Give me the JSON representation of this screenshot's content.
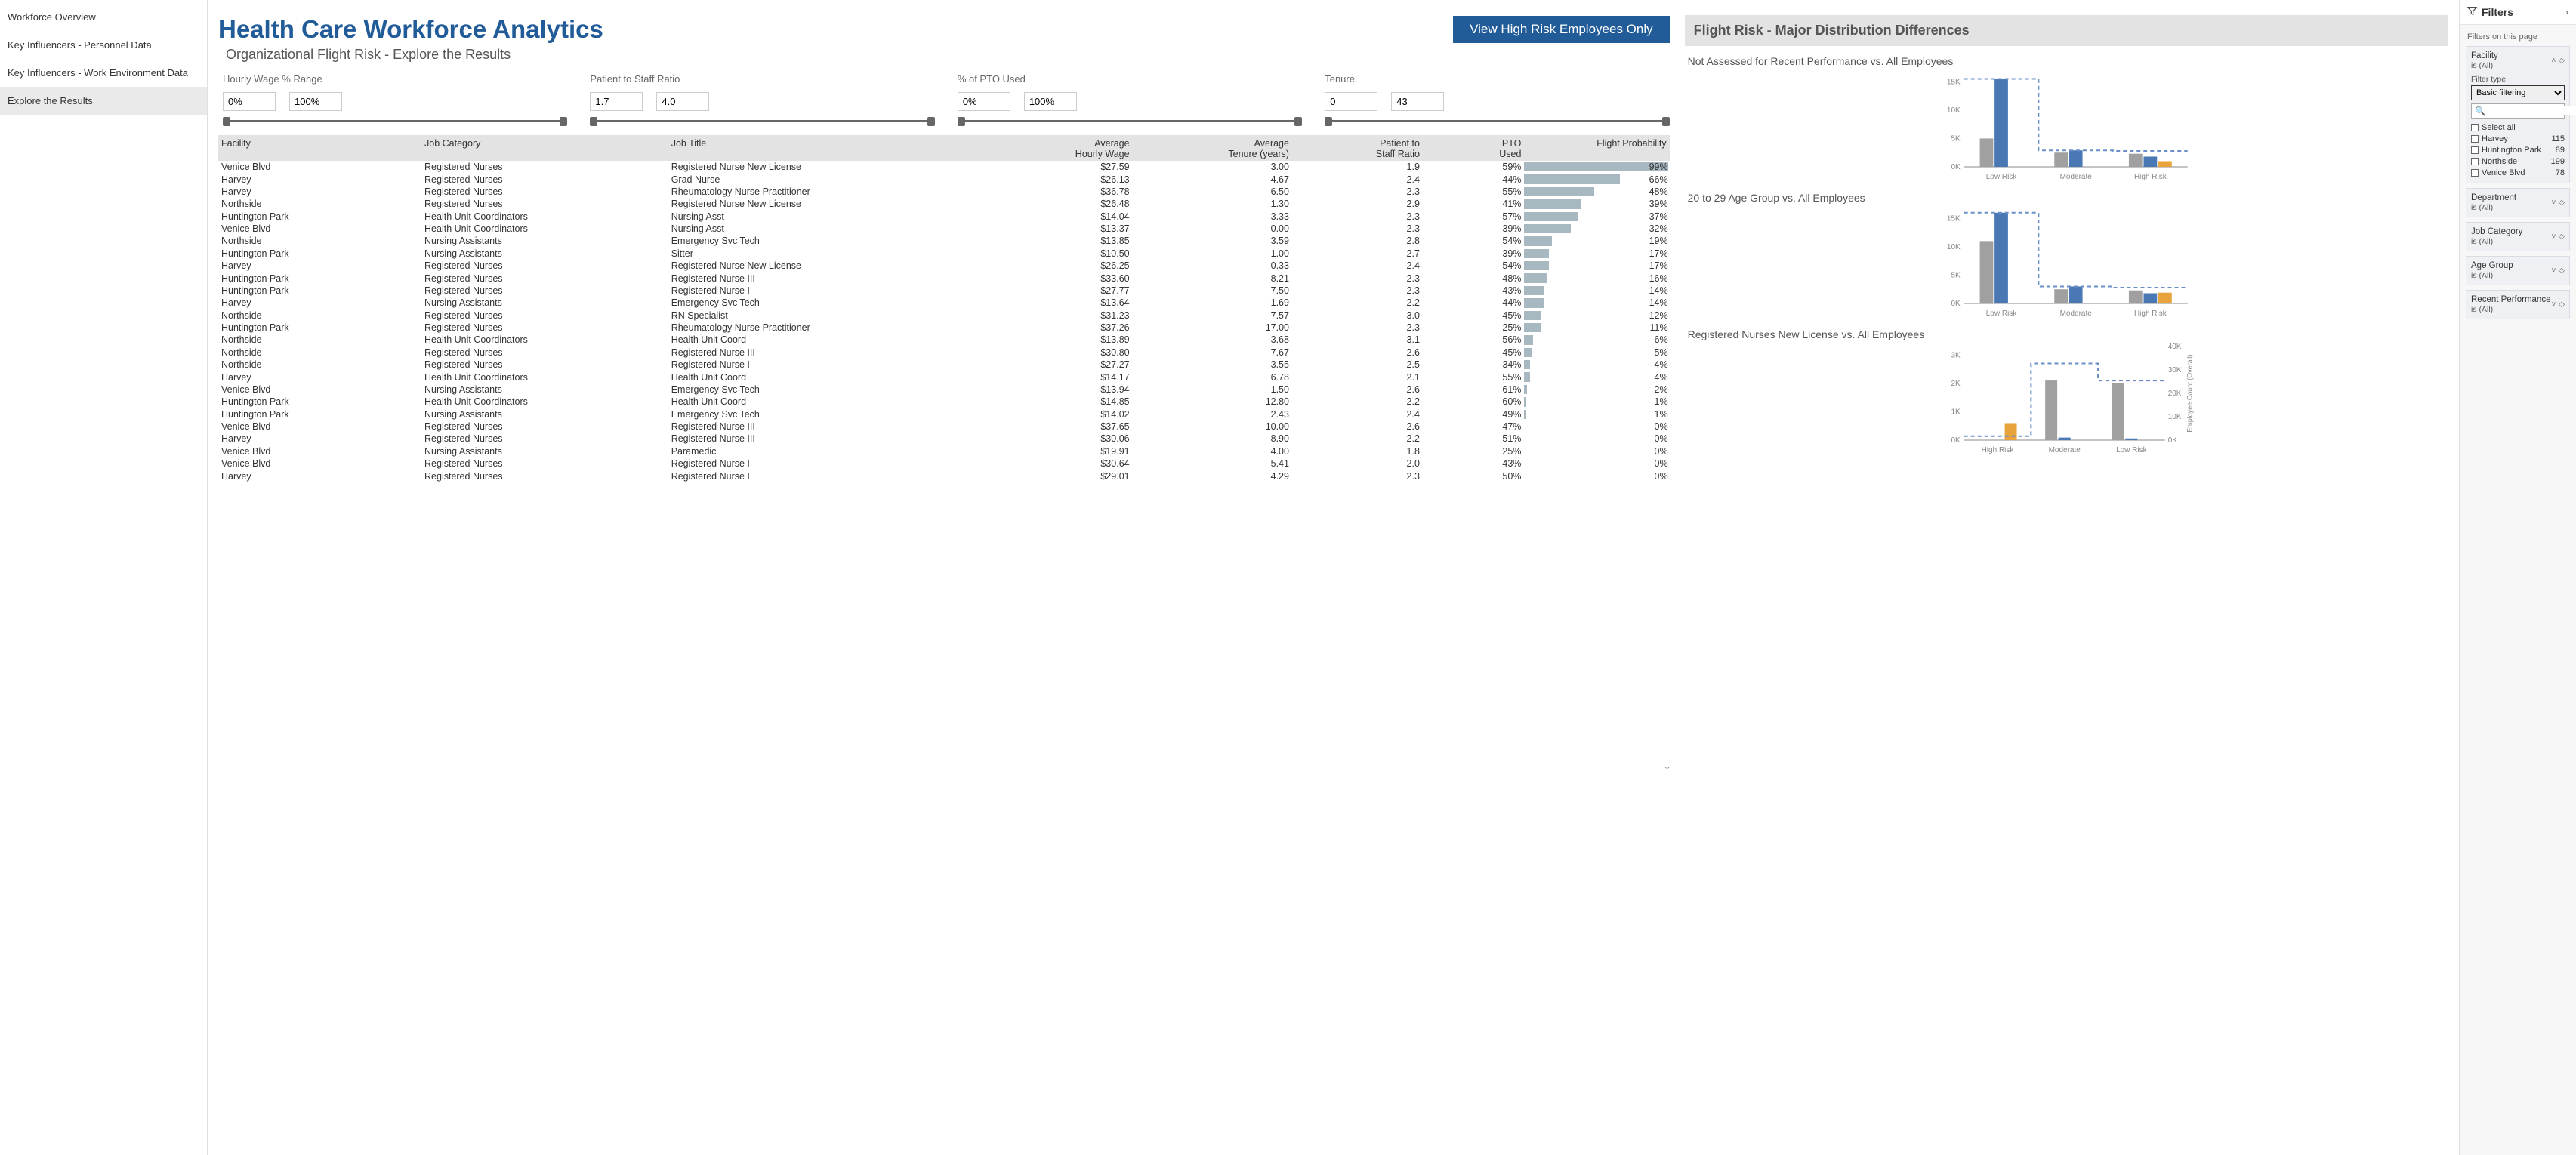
{
  "nav": {
    "items": [
      {
        "label": "Workforce Overview",
        "active": false
      },
      {
        "label": "Key Influencers - Personnel Data",
        "active": false
      },
      {
        "label": "Key Influencers - Work Environment Data",
        "active": false
      },
      {
        "label": "Explore the Results",
        "active": true
      }
    ]
  },
  "header": {
    "title": "Health Care Workforce Analytics",
    "button": "View High Risk Employees Only",
    "subtitle": "Organizational Flight Risk - Explore the Results"
  },
  "slicers": [
    {
      "label": "Hourly Wage % Range",
      "from": "0%",
      "to": "100%"
    },
    {
      "label": "Patient to Staff Ratio",
      "from": "1.7",
      "to": "4.0"
    },
    {
      "label": "% of PTO Used",
      "from": "0%",
      "to": "100%"
    },
    {
      "label": "Tenure",
      "from": "0",
      "to": "43"
    }
  ],
  "table": {
    "columns": [
      "Facility",
      "Job Category",
      "Job Title",
      "Average Hourly Wage",
      "Average Tenure (years)",
      "Patient to Staff Ratio",
      "PTO Used",
      "Flight Probability"
    ],
    "rows": [
      {
        "facility": "Venice Blvd",
        "category": "Registered Nurses",
        "title": "Registered Nurse New License",
        "wage": "$27.59",
        "tenure": "3.00",
        "ratio": "1.9",
        "pto": "59%",
        "prob": "99%",
        "bar": 99
      },
      {
        "facility": "Harvey",
        "category": "Registered Nurses",
        "title": "Grad Nurse",
        "wage": "$26.13",
        "tenure": "4.67",
        "ratio": "2.4",
        "pto": "44%",
        "prob": "66%",
        "bar": 66
      },
      {
        "facility": "Harvey",
        "category": "Registered Nurses",
        "title": "Rheumatology Nurse Practitioner",
        "wage": "$36.78",
        "tenure": "6.50",
        "ratio": "2.3",
        "pto": "55%",
        "prob": "48%",
        "bar": 48
      },
      {
        "facility": "Northside",
        "category": "Registered Nurses",
        "title": "Registered Nurse New License",
        "wage": "$26.48",
        "tenure": "1.30",
        "ratio": "2.9",
        "pto": "41%",
        "prob": "39%",
        "bar": 39
      },
      {
        "facility": "Huntington Park",
        "category": "Health Unit Coordinators",
        "title": "Nursing Asst",
        "wage": "$14.04",
        "tenure": "3.33",
        "ratio": "2.3",
        "pto": "57%",
        "prob": "37%",
        "bar": 37
      },
      {
        "facility": "Venice Blvd",
        "category": "Health Unit Coordinators",
        "title": "Nursing Asst",
        "wage": "$13.37",
        "tenure": "0.00",
        "ratio": "2.3",
        "pto": "39%",
        "prob": "32%",
        "bar": 32
      },
      {
        "facility": "Northside",
        "category": "Nursing Assistants",
        "title": "Emergency Svc Tech",
        "wage": "$13.85",
        "tenure": "3.59",
        "ratio": "2.8",
        "pto": "54%",
        "prob": "19%",
        "bar": 19
      },
      {
        "facility": "Huntington Park",
        "category": "Nursing Assistants",
        "title": "Sitter",
        "wage": "$10.50",
        "tenure": "1.00",
        "ratio": "2.7",
        "pto": "39%",
        "prob": "17%",
        "bar": 17
      },
      {
        "facility": "Harvey",
        "category": "Registered Nurses",
        "title": "Registered Nurse New License",
        "wage": "$26.25",
        "tenure": "0.33",
        "ratio": "2.4",
        "pto": "54%",
        "prob": "17%",
        "bar": 17
      },
      {
        "facility": "Huntington Park",
        "category": "Registered Nurses",
        "title": "Registered Nurse III",
        "wage": "$33.60",
        "tenure": "8.21",
        "ratio": "2.3",
        "pto": "48%",
        "prob": "16%",
        "bar": 16
      },
      {
        "facility": "Huntington Park",
        "category": "Registered Nurses",
        "title": "Registered Nurse I",
        "wage": "$27.77",
        "tenure": "7.50",
        "ratio": "2.3",
        "pto": "43%",
        "prob": "14%",
        "bar": 14
      },
      {
        "facility": "Harvey",
        "category": "Nursing Assistants",
        "title": "Emergency Svc Tech",
        "wage": "$13.64",
        "tenure": "1.69",
        "ratio": "2.2",
        "pto": "44%",
        "prob": "14%",
        "bar": 14
      },
      {
        "facility": "Northside",
        "category": "Registered Nurses",
        "title": "RN Specialist",
        "wage": "$31.23",
        "tenure": "7.57",
        "ratio": "3.0",
        "pto": "45%",
        "prob": "12%",
        "bar": 12
      },
      {
        "facility": "Huntington Park",
        "category": "Registered Nurses",
        "title": "Rheumatology Nurse Practitioner",
        "wage": "$37.26",
        "tenure": "17.00",
        "ratio": "2.3",
        "pto": "25%",
        "prob": "11%",
        "bar": 11
      },
      {
        "facility": "Northside",
        "category": "Health Unit Coordinators",
        "title": "Health Unit Coord",
        "wage": "$13.89",
        "tenure": "3.68",
        "ratio": "3.1",
        "pto": "56%",
        "prob": "6%",
        "bar": 6
      },
      {
        "facility": "Northside",
        "category": "Registered Nurses",
        "title": "Registered Nurse III",
        "wage": "$30.80",
        "tenure": "7.67",
        "ratio": "2.6",
        "pto": "45%",
        "prob": "5%",
        "bar": 5
      },
      {
        "facility": "Northside",
        "category": "Registered Nurses",
        "title": "Registered Nurse I",
        "wage": "$27.27",
        "tenure": "3.55",
        "ratio": "2.5",
        "pto": "34%",
        "prob": "4%",
        "bar": 4
      },
      {
        "facility": "Harvey",
        "category": "Health Unit Coordinators",
        "title": "Health Unit Coord",
        "wage": "$14.17",
        "tenure": "6.78",
        "ratio": "2.1",
        "pto": "55%",
        "prob": "4%",
        "bar": 4
      },
      {
        "facility": "Venice Blvd",
        "category": "Nursing Assistants",
        "title": "Emergency Svc Tech",
        "wage": "$13.94",
        "tenure": "1.50",
        "ratio": "2.6",
        "pto": "61%",
        "prob": "2%",
        "bar": 2
      },
      {
        "facility": "Huntington Park",
        "category": "Health Unit Coordinators",
        "title": "Health Unit Coord",
        "wage": "$14.85",
        "tenure": "12.80",
        "ratio": "2.2",
        "pto": "60%",
        "prob": "1%",
        "bar": 1
      },
      {
        "facility": "Huntington Park",
        "category": "Nursing Assistants",
        "title": "Emergency Svc Tech",
        "wage": "$14.02",
        "tenure": "2.43",
        "ratio": "2.4",
        "pto": "49%",
        "prob": "1%",
        "bar": 1
      },
      {
        "facility": "Venice Blvd",
        "category": "Registered Nurses",
        "title": "Registered Nurse III",
        "wage": "$37.65",
        "tenure": "10.00",
        "ratio": "2.6",
        "pto": "47%",
        "prob": "0%",
        "bar": 0
      },
      {
        "facility": "Harvey",
        "category": "Registered Nurses",
        "title": "Registered Nurse III",
        "wage": "$30.06",
        "tenure": "8.90",
        "ratio": "2.2",
        "pto": "51%",
        "prob": "0%",
        "bar": 0
      },
      {
        "facility": "Venice Blvd",
        "category": "Nursing Assistants",
        "title": "Paramedic",
        "wage": "$19.91",
        "tenure": "4.00",
        "ratio": "1.8",
        "pto": "25%",
        "prob": "0%",
        "bar": 0
      },
      {
        "facility": "Venice Blvd",
        "category": "Registered Nurses",
        "title": "Registered Nurse I",
        "wage": "$30.64",
        "tenure": "5.41",
        "ratio": "2.0",
        "pto": "43%",
        "prob": "0%",
        "bar": 0
      },
      {
        "facility": "Harvey",
        "category": "Registered Nurses",
        "title": "Registered Nurse I",
        "wage": "$29.01",
        "tenure": "4.29",
        "ratio": "2.3",
        "pto": "50%",
        "prob": "0%",
        "bar": 0
      }
    ]
  },
  "right_header": "Flight Risk - Major Distribution Differences",
  "charts": [
    {
      "title": "Not Assessed for Recent Performance vs. All Employees",
      "categories": [
        "Low Risk",
        "Moderate",
        "High Risk"
      ],
      "y_ticks": [
        "0K",
        "5K",
        "10K",
        "15K"
      ],
      "series": {
        "gray": [
          5000,
          2500,
          2300
        ],
        "blue": [
          15500,
          2900,
          1800
        ],
        "orange": [
          0,
          0,
          1000
        ]
      },
      "dash": [
        15500,
        2900,
        2800
      ]
    },
    {
      "title": "20 to 29 Age Group vs. All Employees",
      "categories": [
        "Low Risk",
        "Moderate",
        "High Risk"
      ],
      "y_ticks": [
        "0K",
        "5K",
        "10K",
        "15K"
      ],
      "series": {
        "gray": [
          11000,
          2500,
          2300
        ],
        "blue": [
          16000,
          3000,
          1800
        ],
        "orange": [
          0,
          0,
          1900
        ]
      },
      "dash": [
        16000,
        3000,
        2800
      ]
    },
    {
      "title": "Registered Nurses New License vs. All Employees",
      "categories": [
        "High Risk",
        "Moderate",
        "Low Risk"
      ],
      "y_ticks": [
        "0K",
        "1K",
        "2K",
        "3K"
      ],
      "y_ticks_right": [
        "0K",
        "10K",
        "20K",
        "30K",
        "40K"
      ],
      "y_right_label": "Employee Count (Overall)",
      "series": {
        "orange": [
          600,
          0,
          0
        ],
        "gray": [
          0,
          2100,
          2000
        ],
        "blue": [
          0,
          90,
          60
        ]
      },
      "dash": [
        140,
        2700,
        2100
      ]
    }
  ],
  "chart_data": [
    {
      "type": "bar",
      "title": "Not Assessed for Recent Performance vs. All Employees",
      "categories": [
        "Low Risk",
        "Moderate",
        "High Risk"
      ],
      "series": [
        {
          "name": "group-a",
          "values": [
            5000,
            2500,
            2300
          ]
        },
        {
          "name": "group-b",
          "values": [
            15500,
            2900,
            1800
          ]
        },
        {
          "name": "group-c",
          "values": [
            0,
            0,
            1000
          ]
        }
      ],
      "overlay_line": [
        15500,
        2900,
        2800
      ],
      "ylim": [
        0,
        15000
      ],
      "ylabel": ""
    },
    {
      "type": "bar",
      "title": "20 to 29 Age Group vs. All Employees",
      "categories": [
        "Low Risk",
        "Moderate",
        "High Risk"
      ],
      "series": [
        {
          "name": "group-a",
          "values": [
            11000,
            2500,
            2300
          ]
        },
        {
          "name": "group-b",
          "values": [
            16000,
            3000,
            1800
          ]
        },
        {
          "name": "group-c",
          "values": [
            0,
            0,
            1900
          ]
        }
      ],
      "overlay_line": [
        16000,
        3000,
        2800
      ],
      "ylim": [
        0,
        15000
      ],
      "ylabel": ""
    },
    {
      "type": "bar",
      "title": "Registered Nurses New License vs. All Employees",
      "categories": [
        "High Risk",
        "Moderate",
        "Low Risk"
      ],
      "series": [
        {
          "name": "group-a",
          "values": [
            600,
            0,
            0
          ]
        },
        {
          "name": "group-b",
          "values": [
            0,
            2100,
            2000
          ]
        },
        {
          "name": "group-c",
          "values": [
            0,
            90,
            60
          ]
        }
      ],
      "overlay_line": [
        140,
        2700,
        2100
      ],
      "ylim": [
        0,
        3000
      ],
      "ylim_right": [
        0,
        40000
      ],
      "ylabel": "",
      "ylabel_right": "Employee Count (Overall)"
    }
  ],
  "filters": {
    "pane_title": "Filters",
    "section": "Filters on this page",
    "cards": [
      {
        "title": "Facility",
        "sub": "is (All)",
        "expanded": true,
        "filter_type_label": "Filter type",
        "filter_type_value": "Basic filtering",
        "search_placeholder": "",
        "options": [
          {
            "label": "Select all",
            "count": ""
          },
          {
            "label": "Harvey",
            "count": "115"
          },
          {
            "label": "Huntington Park",
            "count": "89"
          },
          {
            "label": "Northside",
            "count": "199"
          },
          {
            "label": "Venice Blvd",
            "count": "78"
          }
        ]
      },
      {
        "title": "Department",
        "sub": "is (All)",
        "expanded": false
      },
      {
        "title": "Job Category",
        "sub": "is (All)",
        "expanded": false
      },
      {
        "title": "Age Group",
        "sub": "is (All)",
        "expanded": false
      },
      {
        "title": "Recent Performance",
        "sub": "is (All)",
        "expanded": false
      }
    ]
  }
}
